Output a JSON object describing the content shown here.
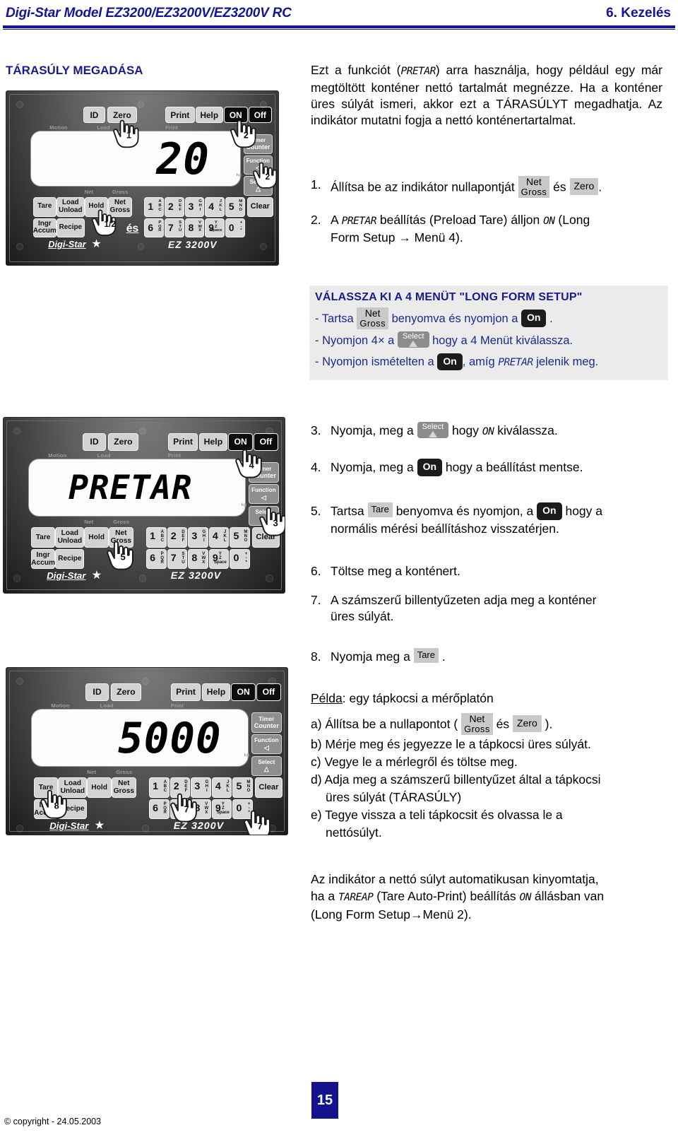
{
  "header": {
    "title": "Digi-Star Model EZ3200/EZ3200V/EZ3200V RC",
    "chapter": "6. Kezelés"
  },
  "section": {
    "heading": "TÁRASÚLY MEGADÁSA"
  },
  "intro": {
    "text_before": "Ezt a funkciót (",
    "code": "PRETAR",
    "text_after": ") arra használja, hogy például egy már megtöltött konténer nettó tartalmát megnézze. Ha a konténer üres súlyát ismeri, akkor ezt a TÁRASÚLYT megadhatja. Az indikátor mutatni fogja a nettó konténertartalmat."
  },
  "steps": [
    {
      "n": "1.",
      "parts": [
        "Állítsa be az indikátor nullapontját ",
        "[Net/Gross]",
        " és ",
        "[Zero]",
        "."
      ]
    },
    {
      "n": "2.",
      "parts": [
        "A ",
        "PRETAR",
        " beállítás (Preload Tare) álljon ",
        "ON",
        " (Long Form Setup ",
        "→",
        " Menü 4)."
      ]
    },
    {
      "n": "3.",
      "parts": [
        "Nyomja, meg a ",
        "[Select]",
        " hogy ",
        "ON",
        " kiválassza."
      ]
    },
    {
      "n": "4.",
      "parts": [
        "Nyomja, meg a ",
        "[On]",
        " hogy a beállítást mentse."
      ]
    },
    {
      "n": "5.",
      "parts": [
        "Tartsa ",
        "[Tare]",
        " benyomva és nyomjon, a ",
        "[On]",
        " hogy a normális mérési beállításhoz visszatérjen."
      ]
    },
    {
      "n": "6.",
      "parts": [
        "Töltse meg a konténert."
      ]
    },
    {
      "n": "7.",
      "parts": [
        "A számszerű billentyűzeten adja meg a konténer üres súlyát."
      ]
    },
    {
      "n": "8.",
      "parts": [
        "Nyomja meg a ",
        "[Tare]",
        " ."
      ]
    }
  ],
  "step1": {
    "text": "Állítsa be az indikátor nullapontját",
    "and": "és",
    "period": "."
  },
  "step2": {
    "a": "A",
    "code": "PRETAR",
    "b": "beállítás (Preload Tare) álljon",
    "on": "ON",
    "c": "(Long",
    "line2": "Form Setup → Menü 4)."
  },
  "callout": {
    "heading": "VÁLASSZA KI A 4  MENÜT  \"LONG FORM SETUP\"",
    "line1_a": "- Tartsa",
    "line1_b": "benyomva és nyomjon a",
    "line1_c": ".",
    "line2_a": "-  Nyomjon 4× a",
    "line2_b": "hogy a  4  Menüt kiválassza.",
    "line3_a": "- Nyomjon ismételten a",
    "line3_b": ", amíg",
    "line3_code": "PRETAR",
    "line3_c": "jelenik meg."
  },
  "step3": {
    "a": "Nyomja, meg a",
    "b": "hogy",
    "on": "ON",
    "c": "kiválassza."
  },
  "step4": {
    "a": "Nyomja, meg a",
    "b": "hogy a beállítást mentse."
  },
  "step5": {
    "a": "Tartsa",
    "b": "benyomva és nyomjon, a",
    "c": "hogy a",
    "line2": "normális mérési beállításhoz visszatérjen."
  },
  "step6": {
    "text": "Töltse meg a konténert."
  },
  "step7": {
    "line1": "A számszerű billentyűzeten adja meg a konténer",
    "line2": "üres súlyát."
  },
  "step8": {
    "a": "Nyomja meg a",
    "b": "."
  },
  "example": {
    "label": "Példa",
    "title_rest": ": egy tápkocsi a mérőplatón",
    "a_pre": "a) Állítsa be a nullapontot (",
    "a_and": "és",
    "a_post": ").",
    "b": "b) Mérje meg és jegyezze le a tápkocsi üres súlyát.",
    "c": "c) Vegye le a mérlegről és töltse meg.",
    "d1": "d) Adja meg a számszerű billentyűzet által a tápkocsi",
    "d2": "üres súlyát (TÁRASÚLY)",
    "e1": "e) Tegye vissza a teli tápkocsit és olvassa le a",
    "e2": "nettósúlyt."
  },
  "note": {
    "line1": "Az indikátor a nettó súlyt automatikusan kinyomtatja,",
    "line2_a": "ha a",
    "line2_code": "TAREAP",
    "line2_b": "(Tare Auto-Print) beállítás",
    "line2_on": "ON",
    "line2_c": "állásban van",
    "line3": "(Long Form Setup→Menü 2)."
  },
  "keys": {
    "net": "Net",
    "gross": "Gross",
    "zero": "Zero",
    "tare": "Tare",
    "on": "On",
    "select": "Select"
  },
  "device": {
    "top_buttons": [
      "ID",
      "Zero",
      "Print",
      "Help",
      "ON",
      "Off"
    ],
    "micro_labels": [
      "Motion",
      "Load",
      "Print",
      "Net",
      "Gross",
      "kg"
    ],
    "side_buttons": [
      {
        "l1": "Timer",
        "l2": "Counter"
      },
      {
        "l1": "Function",
        "l2": "◁"
      },
      {
        "l1": "Select",
        "l2": "△"
      }
    ],
    "func_buttons": [
      {
        "l1": "Tare",
        "l2": ""
      },
      {
        "l1": "Load",
        "l2": "Unload"
      },
      {
        "l1": "Hold",
        "l2": ""
      },
      {
        "l1": "Net",
        "l2": "Gross"
      },
      {
        "l1": "Ingr",
        "l2": "Accum"
      },
      {
        "l1": "Recipe",
        "l2": ""
      }
    ],
    "clear": "Clear",
    "numpad_row1": [
      {
        "d": "1",
        "a": "A\nB\nC"
      },
      {
        "d": "2",
        "a": "D\nE\nF"
      },
      {
        "d": "3",
        "a": "G\nH\nI"
      },
      {
        "d": "4",
        "a": "J\nK\nL"
      },
      {
        "d": "5",
        "a": "M\nN\nO"
      }
    ],
    "numpad_row2": [
      {
        "d": "6",
        "a": "P\nQ\nR"
      },
      {
        "d": "7",
        "a": "S\nT\nU"
      },
      {
        "d": "8",
        "a": "V\nW\nX"
      },
      {
        "d": "9",
        "a": "Y\nZ\nSpace"
      },
      {
        "d": "0",
        "a": "+\n-\n*"
      }
    ],
    "brand": "Digi-Star",
    "model": "EZ 3200V"
  },
  "panel1": {
    "display": "20",
    "hand_labels": [
      "1",
      "2",
      "2",
      "1/2"
    ],
    "es": "és"
  },
  "panel2": {
    "display": "PRETAR",
    "hand_labels": [
      "4",
      "3",
      "5"
    ]
  },
  "panel3": {
    "display": "5000",
    "hand_labels": [
      "8",
      "7",
      "7"
    ]
  },
  "footer": {
    "page": "15",
    "copyright": "© copyright - 24.05.2003"
  },
  "colors": {
    "brand_blue": "#141499",
    "callout_bg": "#ebebeb",
    "key_chip": "#c9c9c9"
  }
}
